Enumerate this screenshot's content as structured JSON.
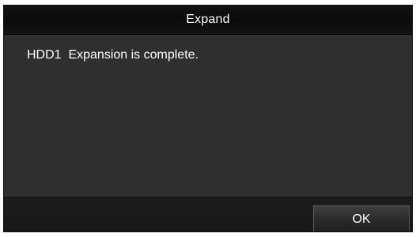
{
  "dialog": {
    "title": "Expand",
    "message": "HDD1  Expansion is complete.",
    "ok_label": "OK"
  },
  "colors": {
    "title_bar": "#0e0e0e",
    "body": "#2f2f2f",
    "footer": "#1a1a1a",
    "text": "#ffffff"
  }
}
